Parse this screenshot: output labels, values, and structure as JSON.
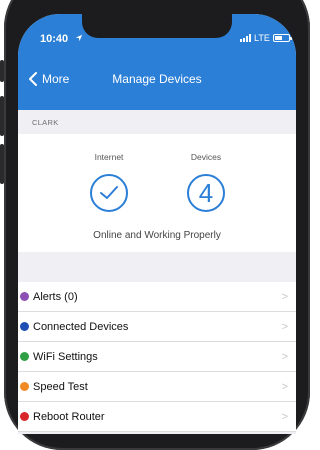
{
  "status_bar": {
    "time": "10:40",
    "network": "LTE",
    "battery_fraction": 0.55
  },
  "nav": {
    "back_label": "More",
    "title": "Manage Devices"
  },
  "section_label": "CLARK",
  "status_card": {
    "internet_label": "Internet",
    "devices_label": "Devices",
    "device_count": "4",
    "status_text": "Online and Working Properly"
  },
  "menu": {
    "items": [
      {
        "label": "Alerts (0)",
        "dot_color": "#8e4fb5"
      },
      {
        "label": "Connected Devices",
        "dot_color": "#1f4fb5"
      },
      {
        "label": "WiFi Settings",
        "dot_color": "#2ea043"
      },
      {
        "label": "Speed Test",
        "dot_color": "#f08a24"
      },
      {
        "label": "Reboot Router",
        "dot_color": "#d9262b"
      }
    ]
  },
  "colors": {
    "accent": "#2b7fd6",
    "background": "#efeff4"
  }
}
